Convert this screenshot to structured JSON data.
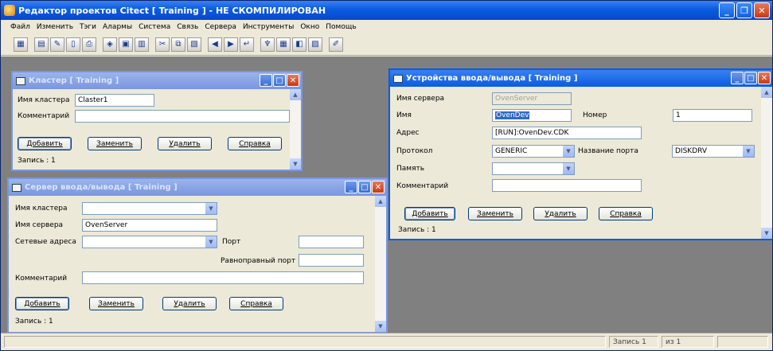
{
  "app": {
    "title": "Редактор проектов Citect [ Training ] - НЕ СКОМПИЛИРОВАН"
  },
  "menu": [
    "Файл",
    "Изменить",
    "Тэги",
    "Алармы",
    "Система",
    "Связь",
    "Сервера",
    "Инструменты",
    "Окно",
    "Помощь"
  ],
  "toolbar_icons": [
    "grid-icon",
    "form-icon",
    "pencil-icon",
    "page-icon",
    "print-icon",
    "tag-icon",
    "alarm-icon",
    "io-icon",
    "cut-icon",
    "copy-icon",
    "paste-icon",
    "first-icon",
    "prev-icon",
    "next-icon",
    "run-icon",
    "find-icon",
    "compile-icon",
    "help-icon",
    "wizard-icon"
  ],
  "cluster_window": {
    "title": "Кластер [ Training ]",
    "name_label": "Имя кластера",
    "name_value": "Claster1",
    "comment_label": "Комментарий",
    "comment_value": "",
    "buttons": {
      "add": "Добавить",
      "replace": "Заменить",
      "delete": "Удалить",
      "help": "Справка"
    },
    "record": "Запись :  1"
  },
  "ioserver_window": {
    "title": "Сервер ввода/вывода [ Training ]",
    "cluster_label": "Имя кластера",
    "cluster_value": "",
    "server_label": "Имя сервера",
    "server_value": "OvenServer",
    "net_label": "Сетевые адреса",
    "net_value": "",
    "port_label": "Порт",
    "port_value": "",
    "peer_port_label": "Равноправный порт",
    "peer_port_value": "",
    "comment_label": "Комментарий",
    "comment_value": "",
    "buttons": {
      "add": "Добавить",
      "replace": "Заменить",
      "delete": "Удалить",
      "help": "Справка"
    },
    "record": "Запись :  1"
  },
  "iodevice_window": {
    "title": "Устройства ввода/вывода [ Training ]",
    "server_label": "Имя сервера",
    "server_value": "OvenServer",
    "name_label": "Имя",
    "name_value": "OvenDev",
    "number_label": "Номер",
    "number_value": "1",
    "address_label": "Адрес",
    "address_value": "[RUN]:OvenDev.CDK",
    "protocol_label": "Протокол",
    "protocol_value": "GENERIC",
    "port_name_label": "Название порта",
    "port_name_value": "DISKDRV",
    "memory_label": "Память",
    "memory_value": "",
    "comment_label": "Комментарий",
    "comment_value": "",
    "buttons": {
      "add": "Добавить",
      "replace": "Заменить",
      "delete": "Удалить",
      "help": "Справка"
    },
    "record": "Запись :  1"
  },
  "status": {
    "record": "Запись 1",
    "of": "из 1"
  },
  "colors": {
    "titlebar": "#0a5be0",
    "mdi_background": "#808080",
    "dialog": "#ece9d8"
  }
}
